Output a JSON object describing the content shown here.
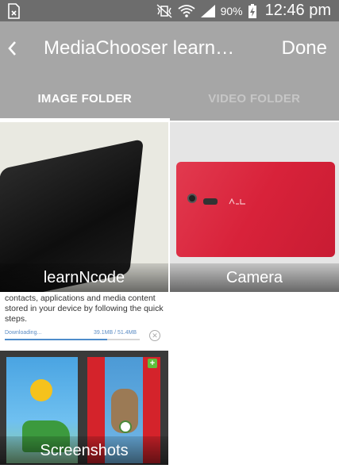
{
  "status_bar": {
    "battery_percent": "90%",
    "time": "12:46 pm"
  },
  "app_bar": {
    "title": "MediaChooser learn…",
    "done_label": "Done"
  },
  "tabs": [
    {
      "label": "IMAGE FOLDER",
      "active": true
    },
    {
      "label": "VIDEO FOLDER",
      "active": false
    }
  ],
  "folders": [
    {
      "label": "learnNcode"
    },
    {
      "label": "Camera"
    },
    {
      "label": "Screenshots"
    }
  ],
  "screenshot_preview": {
    "text": "contacts, applications and media content stored in your device by following the quick steps.",
    "downloading_label": "Downloading...",
    "size_text": "39.1MB / 51.4MB",
    "progress": 0.76
  },
  "colors": {
    "status_bar": "#6d6d6d",
    "app_bar": "#a6a6a6",
    "active_tab_text": "#ffffff",
    "inactive_tab_text": "#c6c6c6",
    "camera_phone": "#d8223a"
  }
}
